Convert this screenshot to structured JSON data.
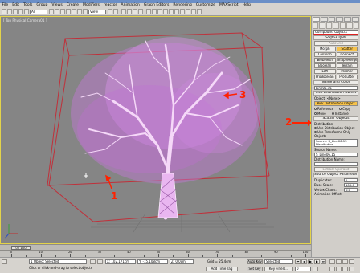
{
  "app": {
    "title": "3ds Max"
  },
  "menu": [
    "File",
    "Edit",
    "Tools",
    "Group",
    "Views",
    "Create",
    "Modifiers",
    "reactor",
    "Animation",
    "Graph Editors",
    "Rendering",
    "Customize",
    "MAXScript",
    "Help"
  ],
  "toolbar": {
    "selection_filter": "All",
    "coord_system": "View"
  },
  "viewport": {
    "label": "[ Top Physical Camera01 ]",
    "annotations": {
      "one": "1",
      "two": "2",
      "three": "3"
    },
    "annotation_color": "#ff2200"
  },
  "command_panel": {
    "category": "Compound Objects",
    "object_type": {
      "title": "Object Type",
      "autogrid": "AutoGrid",
      "buttons": [
        "Morph",
        "Scatter",
        "Conform",
        "Connect",
        "BlobMesh",
        "ShapeMerge",
        "Boolean",
        "Terrain",
        "Loft",
        "Mesher",
        "ProBoolean",
        "ProCutter"
      ]
    },
    "name_color": {
      "title": "Name and Color",
      "name": "Line06.15"
    },
    "pick_distribution": {
      "title": "Pick Distribution Object",
      "object_label": "Object: <None>",
      "pick_button": "Pick Distribution Object",
      "options": [
        "Reference",
        "Copy",
        "Move",
        "Instance"
      ]
    },
    "scatter_objects": {
      "title": "Scatter Objects",
      "distribution_label": "Distribution",
      "options": [
        "Use Distribution Object",
        "Use Transforms Only"
      ],
      "objects_label": "Objects",
      "objects_list": [
        "Source: S_Line06.15",
        "Distribution"
      ],
      "source_name_label": "Source Name:",
      "source_name": "S_Line06.15",
      "distribution_name_label": "Distribution Name:",
      "extract_button": "Extract Operand"
    },
    "source_params": {
      "title": "Source Object Parameters",
      "fields": [
        {
          "label": "Duplicates:",
          "value": "1"
        },
        {
          "label": "Base Scale:",
          "value": "100.0"
        },
        {
          "label": "Vertex Chaos:",
          "value": "0.0"
        }
      ],
      "animation_offset_label": "Animation Offset:"
    }
  },
  "time_slider": {
    "label": "0 / 100"
  },
  "track_ticks": [
    "0",
    "10",
    "20",
    "30",
    "40",
    "50",
    "60",
    "70",
    "80",
    "90",
    "100"
  ],
  "status": {
    "selection": "1 Object Selected",
    "prompt": "Click or click-and-drag to select objects",
    "x_value": "X: 102.171cm",
    "y_value": "Y: -15.108cm",
    "z_value": "Z: 0.0cm",
    "grid": "Grid = 25.4cm",
    "add_time_tag": "Add Time Tag",
    "auto_key": "Auto Key",
    "selected_dropdown": "Selected",
    "set_key": "Set Key",
    "key_filters": "Key Filters...",
    "frame_value": "0"
  },
  "colors": {
    "tree": "#f3c6f7",
    "twigs": "#c86bd6",
    "selection_box": "#c0303a",
    "scatter_button": "#ffd060"
  }
}
